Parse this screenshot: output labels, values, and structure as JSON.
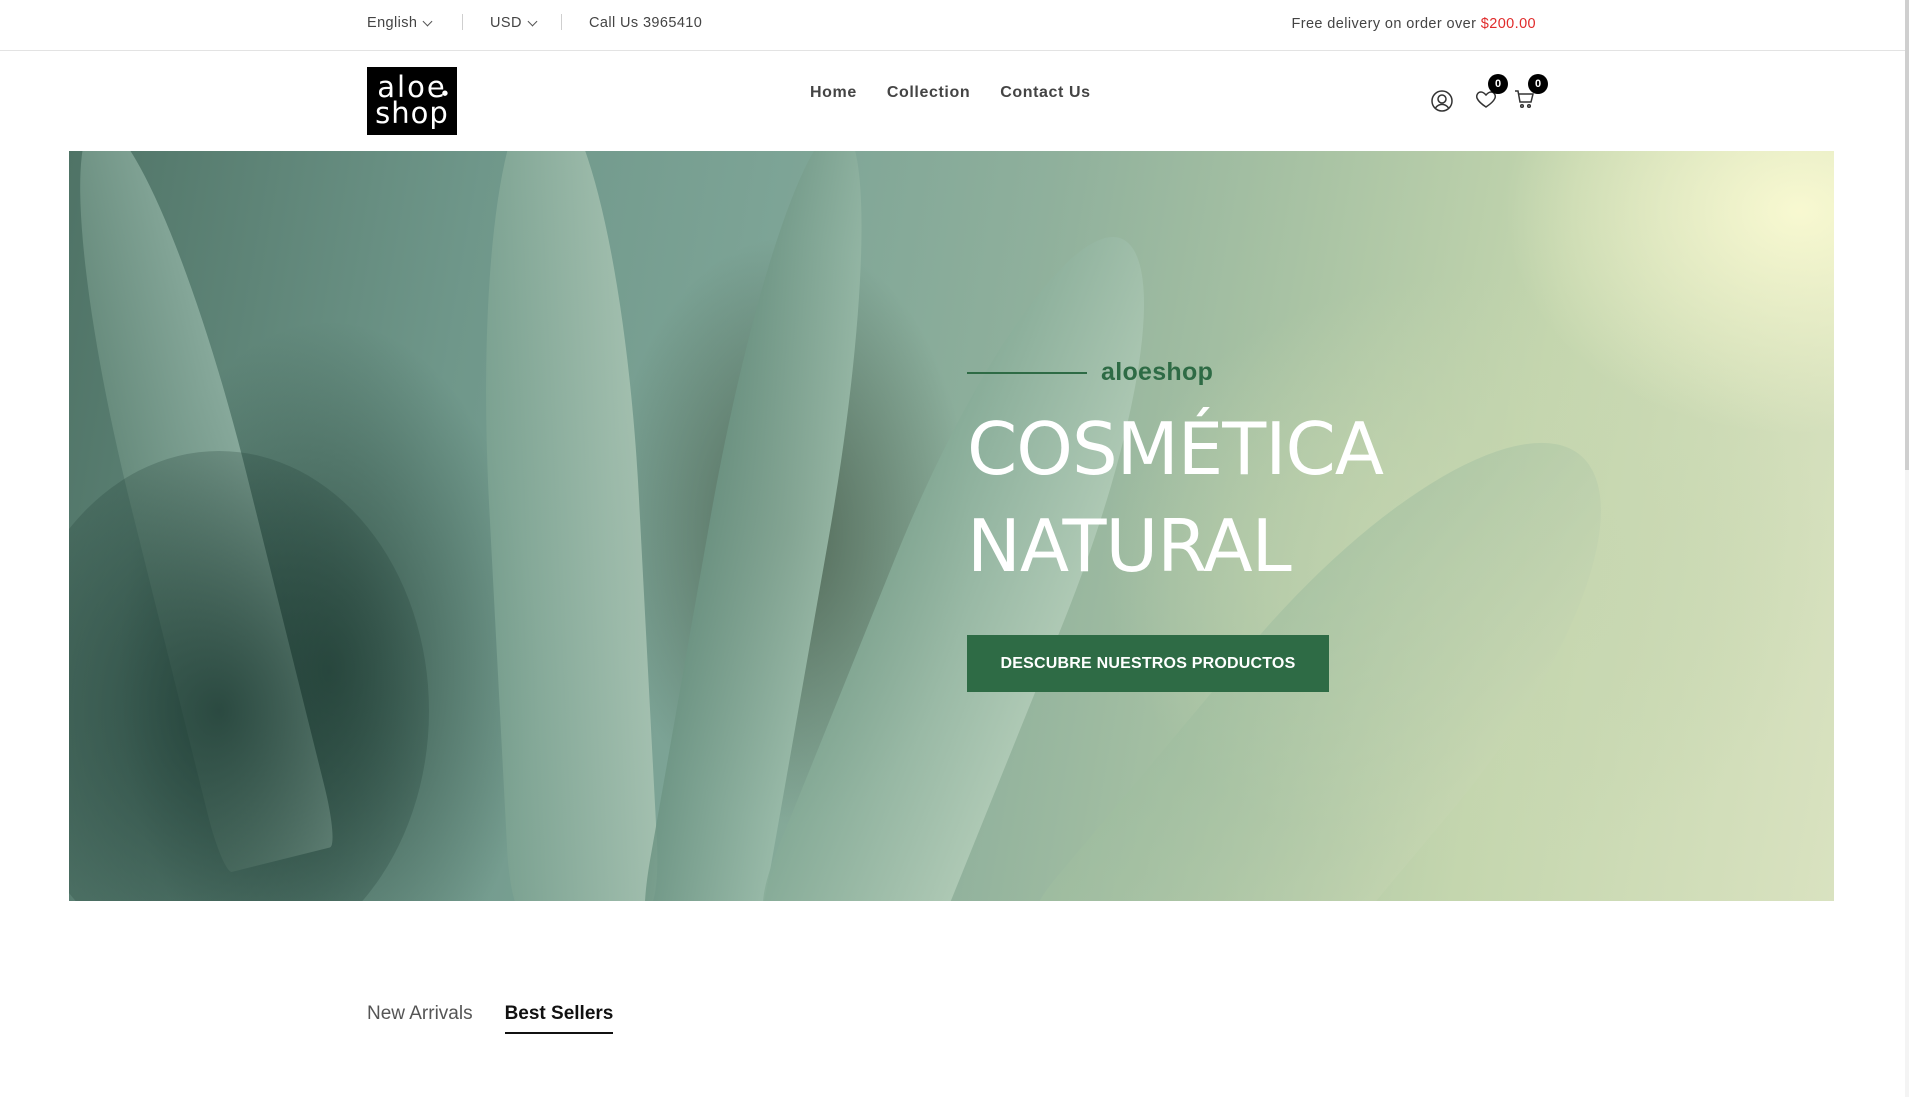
{
  "topbar": {
    "language": "English",
    "currency": "USD",
    "phone": "Call Us 3965410",
    "delivery_text": "Free delivery on order over ",
    "delivery_amount": "$200.00"
  },
  "header": {
    "logo_line1": "aloe",
    "logo_line2": "shop",
    "nav": [
      {
        "label": "Home"
      },
      {
        "label": "Collection"
      },
      {
        "label": "Contact Us"
      }
    ],
    "wishlist_count": "0",
    "cart_count": "0"
  },
  "hero": {
    "brand": "aloeshop",
    "headline_line1": "COSMÉTICA",
    "headline_line2": "NATURAL",
    "cta_label": "DESCUBRE NUESTROS PRODUCTOS"
  },
  "tabs": [
    {
      "label": "New Arrivals",
      "active": false
    },
    {
      "label": "Best Sellers",
      "active": true
    }
  ],
  "colors": {
    "accent_green": "#2e6b45",
    "price_red": "#e02b2b",
    "badge_black": "#000000"
  },
  "icons": [
    "user-icon",
    "heart-icon",
    "cart-icon",
    "chevron-down-icon"
  ]
}
